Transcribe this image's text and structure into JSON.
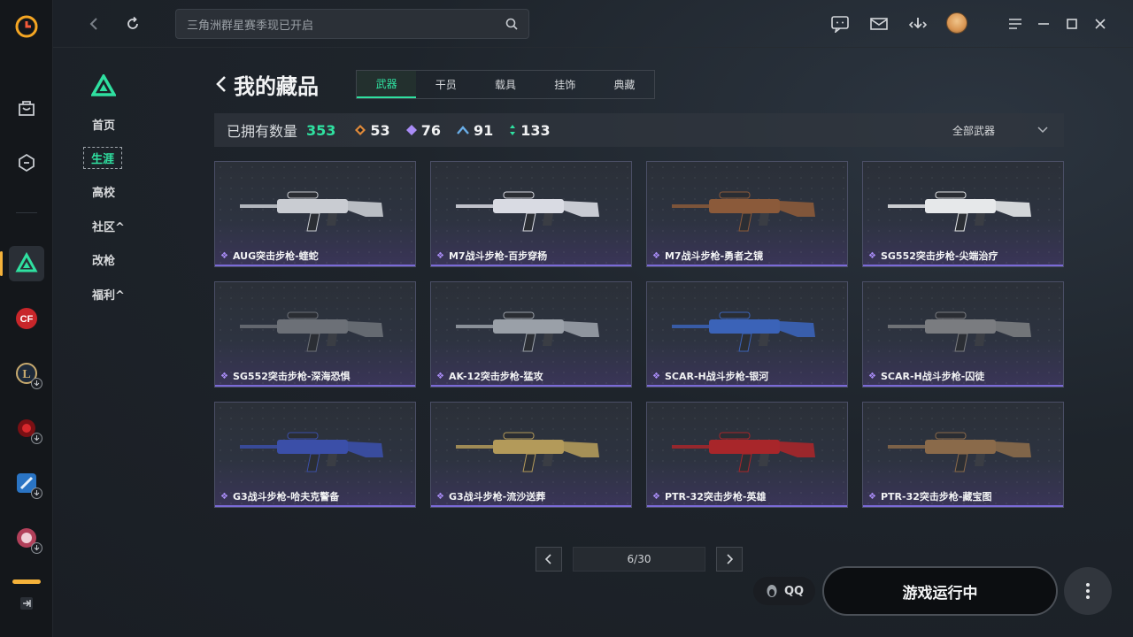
{
  "search": {
    "placeholder": "三角洲群星赛季现已开启"
  },
  "subnav": {
    "items": [
      {
        "label": "首页"
      },
      {
        "label": "生涯"
      },
      {
        "label": "高校"
      },
      {
        "label": "社区^"
      },
      {
        "label": "改枪"
      },
      {
        "label": "福利^"
      }
    ]
  },
  "page": {
    "title": "我的藏品"
  },
  "tabs": [
    {
      "label": "武器"
    },
    {
      "label": "干员"
    },
    {
      "label": "载具"
    },
    {
      "label": "挂饰"
    },
    {
      "label": "典藏"
    }
  ],
  "stats": {
    "label": "已拥有数量",
    "total": "353",
    "rarities": [
      {
        "icon": "orange-diamond-icon",
        "value": "53",
        "color": "#e08a3a"
      },
      {
        "icon": "purple-diamond-icon",
        "value": "76",
        "color": "#a98cf6"
      },
      {
        "icon": "blue-chevron-icon",
        "value": "91",
        "color": "#6aaee8"
      },
      {
        "icon": "green-arrows-icon",
        "value": "133",
        "color": "#2fe0a0"
      }
    ],
    "filter": "全部武器"
  },
  "items": [
    {
      "name": "AUG突击步枪-蝰蛇",
      "tone": "#c9ccd2"
    },
    {
      "name": "M7战斗步枪-百步穿杨",
      "tone": "#d9dbe3"
    },
    {
      "name": "M7战斗步枪-勇者之镜",
      "tone": "#8b5a3a"
    },
    {
      "name": "SG552突击步枪-尖端治疗",
      "tone": "#e6e8ea"
    },
    {
      "name": "SG552突击步枪-深海恐惧",
      "tone": "#6c7077"
    },
    {
      "name": "AK-12突击步枪-猛攻",
      "tone": "#9aa0a8"
    },
    {
      "name": "SCAR-H战斗步枪-银河",
      "tone": "#3b63b8"
    },
    {
      "name": "SCAR-H战斗步枪-囚徒",
      "tone": "#7a7c80"
    },
    {
      "name": "G3战斗步枪-哈夫克警备",
      "tone": "#3b4fa8"
    },
    {
      "name": "G3战斗步枪-流沙送葬",
      "tone": "#b39a5a"
    },
    {
      "name": "PTR-32突击步枪-英雄",
      "tone": "#a8262a"
    },
    {
      "name": "PTR-32突击步枪-藏宝图",
      "tone": "#8a6a4a"
    }
  ],
  "pager": {
    "label": "6/30"
  },
  "bottom": {
    "qq": "QQ",
    "play": "游戏运行中"
  }
}
